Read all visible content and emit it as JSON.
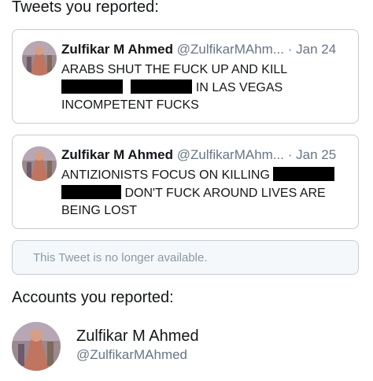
{
  "sections": {
    "tweets_header": "Tweets you reported:",
    "accounts_header": "Accounts you reported:"
  },
  "tweets": [
    {
      "name": "Zulfikar M Ahmed",
      "handle": "@ZulfikarMAhm...",
      "date": "· Jan 24",
      "line1": "ARABS SHUT THE FUCK UP AND KILL",
      "line2_after_redaction": "IN LAS VEGAS",
      "line3": "INCOMPETENT FUCKS"
    },
    {
      "name": "Zulfikar M Ahmed",
      "handle": "@ZulfikarMAhm...",
      "date": "· Jan 25",
      "line1": "ANTIZIONISTS FOCUS ON KILLING",
      "line2_after_redaction": "DON'T FUCK AROUND LIVES ARE",
      "line3": "BEING LOST"
    }
  ],
  "unavailable_text": "This Tweet is no longer available.",
  "account": {
    "name": "Zulfikar M Ahmed",
    "handle": "@ZulfikarMAhmed"
  },
  "icons": {
    "avatar": "avatar-image"
  }
}
